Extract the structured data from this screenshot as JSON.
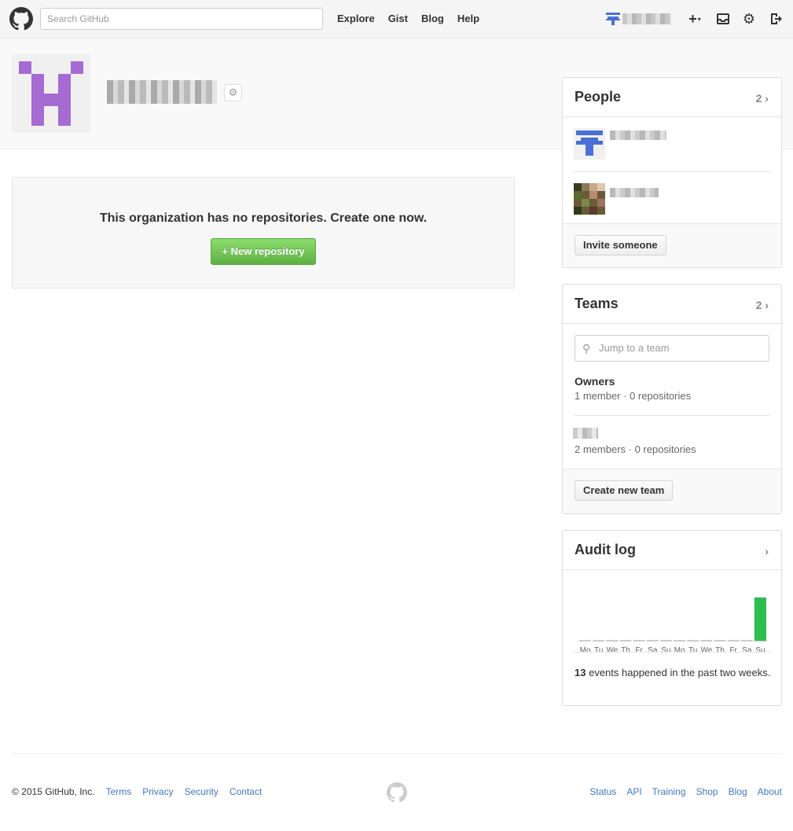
{
  "header": {
    "search_placeholder": "Search GitHub",
    "nav": [
      "Explore",
      "Gist",
      "Blog",
      "Help"
    ],
    "icons": [
      "plus-icon",
      "inbox-icon",
      "gear-icon",
      "signout-icon"
    ]
  },
  "org": {
    "settings_icon": "gear-icon"
  },
  "blankslate": {
    "message": "This organization has no repositories. Create one now.",
    "button_label": "+ New repository"
  },
  "people": {
    "title": "People",
    "count": "2",
    "invite_label": "Invite someone"
  },
  "teams": {
    "title": "Teams",
    "count": "2",
    "search_placeholder": "Jump to a team",
    "items": [
      {
        "name": "Owners",
        "meta": "1 member · 0 repositories"
      },
      {
        "name": "",
        "meta": "2 members · 0 repositories"
      }
    ],
    "create_label": "Create new team"
  },
  "audit": {
    "title": "Audit log",
    "events_count": "13",
    "events_text": "events happened in the past two weeks."
  },
  "chart_data": {
    "type": "bar",
    "categories": [
      "Mo",
      "Tu",
      "We",
      "Th",
      "Fr",
      "Sa",
      "Su",
      "Mo",
      "Tu",
      "We",
      "Th",
      "Fr",
      "Sa",
      "Su"
    ],
    "values": [
      0,
      0,
      0,
      0,
      0,
      0,
      0,
      0,
      0,
      0,
      0,
      0,
      0,
      13
    ],
    "bar_color": "#2cbe4e",
    "baseline_color": "#999999"
  },
  "footer": {
    "copyright": "© 2015 GitHub, Inc.",
    "left_links": [
      "Terms",
      "Privacy",
      "Security",
      "Contact"
    ],
    "right_links": [
      "Status",
      "API",
      "Training",
      "Shop",
      "Blog",
      "About"
    ]
  }
}
